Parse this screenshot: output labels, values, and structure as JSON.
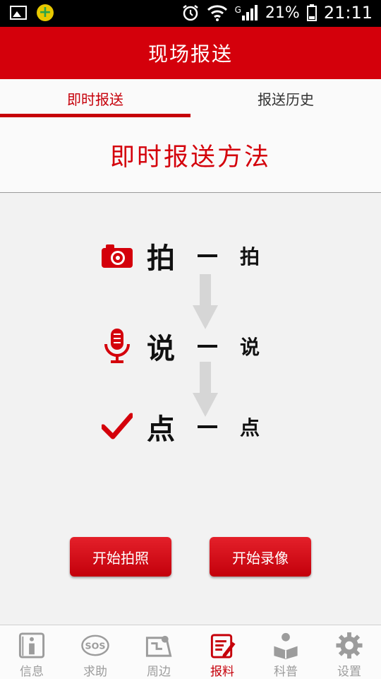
{
  "status_bar": {
    "signal_label": "G",
    "battery": "21%",
    "time": "21:11"
  },
  "header": {
    "title": "现场报送"
  },
  "tabs": [
    {
      "label": "即时报送",
      "active": true
    },
    {
      "label": "报送历史",
      "active": false
    }
  ],
  "method_title": "即时报送方法",
  "steps": [
    {
      "big": "拍",
      "small": "拍",
      "icon": "camera-icon"
    },
    {
      "big": "说",
      "small": "说",
      "icon": "microphone-icon"
    },
    {
      "big": "点",
      "small": "点",
      "icon": "checkmark-icon"
    }
  ],
  "buttons": {
    "photo": "开始拍照",
    "video": "开始录像"
  },
  "bottom_nav": [
    {
      "label": "信息",
      "icon": "info-icon",
      "active": false
    },
    {
      "label": "求助",
      "icon": "sos-icon",
      "active": false
    },
    {
      "label": "周边",
      "icon": "map-icon",
      "active": false
    },
    {
      "label": "报料",
      "icon": "report-icon",
      "active": true
    },
    {
      "label": "科普",
      "icon": "reading-person-icon",
      "active": false
    },
    {
      "label": "设置",
      "icon": "gear-icon",
      "active": false
    }
  ],
  "colors": {
    "accent": "#d4000b",
    "inactive": "#9c9c9c"
  }
}
